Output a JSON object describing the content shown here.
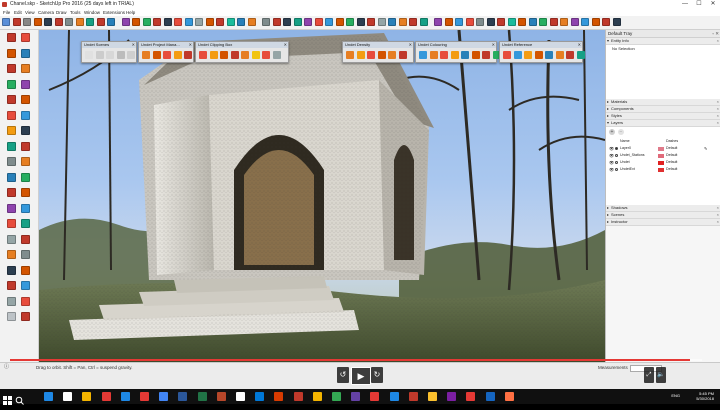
{
  "window": {
    "title": "Chanel.skp - SketchUp Pro 2016 (25 days left in TRIAL)",
    "minimize": "—",
    "maximize": "☐",
    "close": "✕"
  },
  "menu": [
    "File",
    "Edit",
    "View",
    "Camera",
    "Draw",
    "Tools",
    "Window",
    "Extensions",
    "Help"
  ],
  "toolbar_colors": [
    "#5a8fd8",
    "#c0392b",
    "#888888",
    "#d35400",
    "#2c3e50",
    "#c0392b",
    "#7f8c8d",
    "#e67e22",
    "#16a085",
    "#c0392b",
    "#2980b9",
    "#8e44ad",
    "#d35400",
    "#27ae60",
    "#c0392b",
    "#2c3e50",
    "#e74c3c",
    "#3498db",
    "#95a5a6",
    "#d35400",
    "#c0392b",
    "#1abc9c",
    "#2980b9",
    "#e67e22",
    "#7f8c8d",
    "#c0392b",
    "#2c3e50",
    "#16a085",
    "#8e44ad",
    "#e74c3c",
    "#3498db",
    "#d35400",
    "#27ae60",
    "#2c3e50",
    "#c0392b",
    "#95a5a6",
    "#2980b9",
    "#e67e22",
    "#c0392b",
    "#16a085",
    "#8e44ad",
    "#d35400",
    "#3498db",
    "#e74c3c",
    "#7f8c8d",
    "#2c3e50",
    "#c0392b",
    "#1abc9c",
    "#d35400",
    "#2980b9",
    "#27ae60",
    "#c0392b",
    "#e67e22",
    "#8e44ad",
    "#3498db",
    "#d35400",
    "#c0392b",
    "#2c3e50"
  ],
  "floating_toolbars": [
    {
      "title": "Undet Scenes",
      "icons": [
        "#e0e0e0",
        "#cccccc",
        "#d7d7d7",
        "#bcbcbc",
        "#cfcfcf"
      ]
    },
    {
      "title": "Undet Project Mana...",
      "icons": [
        "#e67e22",
        "#d35400",
        "#e74c3c",
        "#f39c12",
        "#c0392b"
      ]
    },
    {
      "title": "Undet Clipping Box",
      "icons": [
        "#e74c3c",
        "#f39c12",
        "#d35400",
        "#c0392b",
        "#e67e22",
        "#f1c40f",
        "#e74c3c",
        "#95a5a6"
      ]
    },
    {
      "title": "Undet Density",
      "icons": [
        "#e67e22",
        "#f39c12",
        "#e74c3c",
        "#d35400",
        "#e67e22",
        "#c0392b"
      ]
    },
    {
      "title": "Undet Colouring",
      "icons": [
        "#3498db",
        "#e67e22",
        "#e74c3c",
        "#f39c12",
        "#2980b9",
        "#d35400",
        "#c0392b",
        "#27ae60"
      ]
    },
    {
      "title": "Undet Reference",
      "icons": [
        "#e74c3c",
        "#3498db",
        "#f39c12",
        "#d35400",
        "#2980b9",
        "#e67e22",
        "#c0392b",
        "#16a085"
      ]
    }
  ],
  "tray": {
    "title": "Default Tray",
    "panels_top": [
      {
        "name": "Entity Info",
        "body": "No Selection"
      }
    ],
    "panels_mid": [
      "Materials",
      "Components",
      "Styles",
      "Layers"
    ],
    "layers": {
      "col_name": "Name",
      "col_dashes": "Dashes",
      "rows": [
        {
          "name": "Layer0",
          "color": "#e07a8a",
          "dashes": "Default",
          "active": true
        },
        {
          "name": "Undet_Stations",
          "color": "#e06a7a",
          "dashes": "Default",
          "active": false
        },
        {
          "name": "Undet",
          "color": "#e02020",
          "dashes": "Default",
          "active": false
        },
        {
          "name": "UndetExt",
          "color": "#e03030",
          "dashes": "Default",
          "active": false
        }
      ]
    },
    "panels_bottom": [
      "Shadows",
      "Scenes",
      "Instructor"
    ]
  },
  "status": {
    "hint": "Drag to orbit. Shift = Pan, Ctrl = suspend gravity.",
    "measurements_label": "Measurements"
  },
  "video": {
    "current": "0:20:11",
    "total": "0:20:35",
    "progress": 0.982
  },
  "taskbar": {
    "language": "ENG",
    "time": "5:45 PM",
    "date": "5/30/2018"
  }
}
